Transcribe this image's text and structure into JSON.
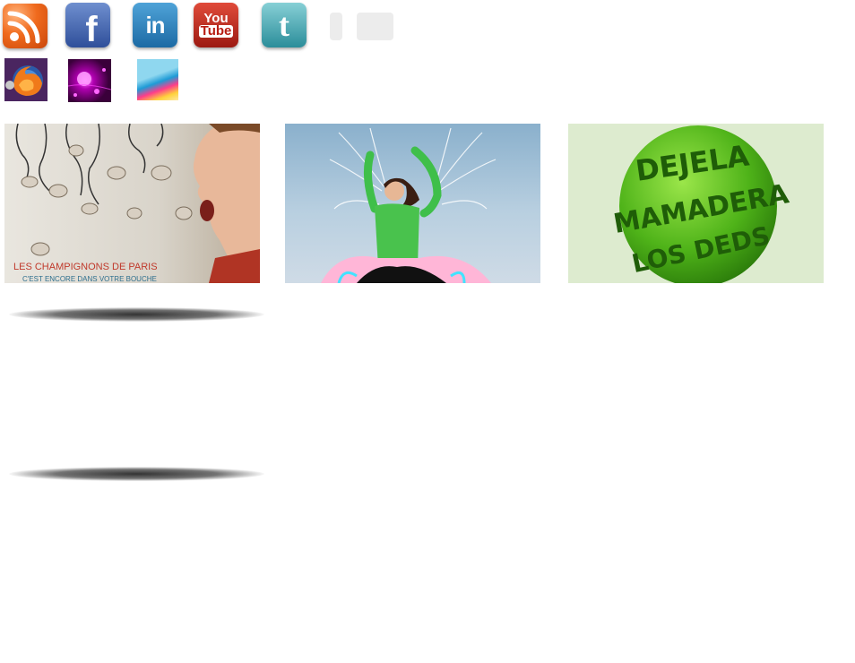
{
  "social_icons": [
    {
      "name": "rss-icon"
    },
    {
      "name": "facebook-icon",
      "glyph": "f"
    },
    {
      "name": "linkedin-icon",
      "glyph": "in"
    },
    {
      "name": "youtube-icon",
      "glyph_top": "You",
      "glyph_bottom": "Tube"
    },
    {
      "name": "twitter-icon",
      "glyph": "t"
    }
  ],
  "thumbnails": [
    {
      "name": "firefox-icon"
    },
    {
      "name": "purple-glow-thumbnail"
    },
    {
      "name": "color-waves-thumbnail"
    }
  ],
  "cards": [
    {
      "name": "champignons-card",
      "caption_line1": "LES CHAMPIGNONS DE PARIS",
      "caption_line2": "C'EST ENCORE DANS VOTRE BOUCHE"
    },
    {
      "name": "dancer-splash-card"
    },
    {
      "name": "green-typography-sphere-card",
      "sphere_text": [
        "DEJELA",
        "MAMADERA",
        "LOS DEDS"
      ]
    }
  ],
  "colors": {
    "rss": "#f06a1d",
    "facebook": "#3b5998",
    "linkedin": "#1c6aa4",
    "youtube": "#c4302b",
    "twitter": "#2b8d9a"
  }
}
